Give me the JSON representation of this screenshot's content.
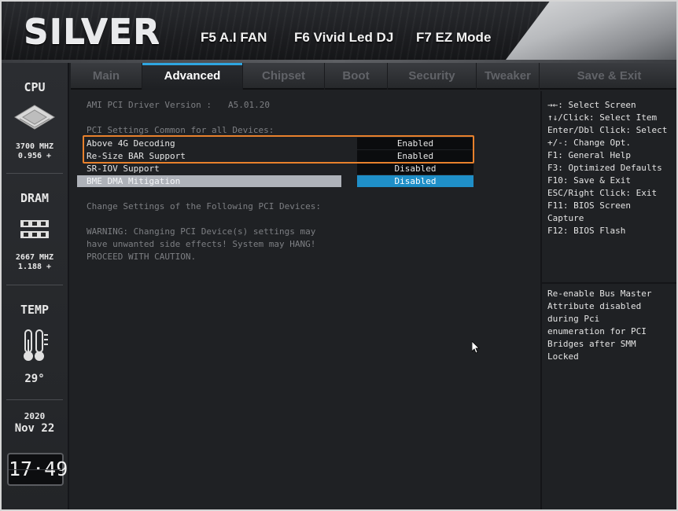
{
  "header": {
    "logo": "SILVER",
    "fkeys": [
      "F5 A.I FAN",
      "F6 Vivid Led DJ",
      "F7 EZ Mode"
    ]
  },
  "sidebar": {
    "cpu": {
      "label": "CPU",
      "freq": "3700 MHZ",
      "volt": "0.956 +"
    },
    "dram": {
      "label": "DRAM",
      "freq": "2667 MHZ",
      "volt": "1.188 +"
    },
    "temp": {
      "label": "TEMP",
      "value": "29°"
    },
    "date": {
      "year": "2020",
      "day": "Nov 22"
    },
    "time": {
      "hour": "17",
      "minute": "49"
    }
  },
  "tabs": [
    "Main",
    "Advanced",
    "Chipset",
    "Boot",
    "Security",
    "Tweaker",
    "Save & Exit"
  ],
  "active_tab": "Advanced",
  "main": {
    "driver_version_label": "AMI PCI Driver Version :",
    "driver_version_value": "A5.01.20",
    "section_title": "PCI Settings Common for all Devices:",
    "options": [
      {
        "label": "Above 4G Decoding",
        "value": "Enabled"
      },
      {
        "label": "Re-Size BAR Support",
        "value": "Enabled"
      },
      {
        "label": "SR-IOV Support",
        "value": "Disabled"
      },
      {
        "label": "BME DMA Mitigation",
        "value": "Disabled"
      }
    ],
    "change_settings": "Change Settings of the Following PCI Devices:",
    "warning": [
      "WARNING: Changing PCI Device(s) settings may",
      "have unwanted side effects! System may HANG!",
      "PROCEED WITH CAUTION."
    ]
  },
  "help": {
    "keys": [
      "→←: Select Screen",
      "↑↓/Click: Select Item",
      "Enter/Dbl Click: Select",
      "+/-: Change Opt.",
      "F1: General Help",
      "F3: Optimized Defaults",
      "F10: Save & Exit",
      "ESC/Right Click: Exit",
      "F11: BIOS Screen",
      "Capture",
      "F12: BIOS Flash"
    ],
    "description": [
      "Re-enable Bus Master",
      "Attribute disabled",
      "during Pci",
      "enumeration for PCI",
      "Bridges after SMM",
      "Locked"
    ]
  },
  "colors": {
    "accent": "#2fa6e0",
    "highlight_box": "#e8812c",
    "selected_value": "#1f8fc8"
  }
}
